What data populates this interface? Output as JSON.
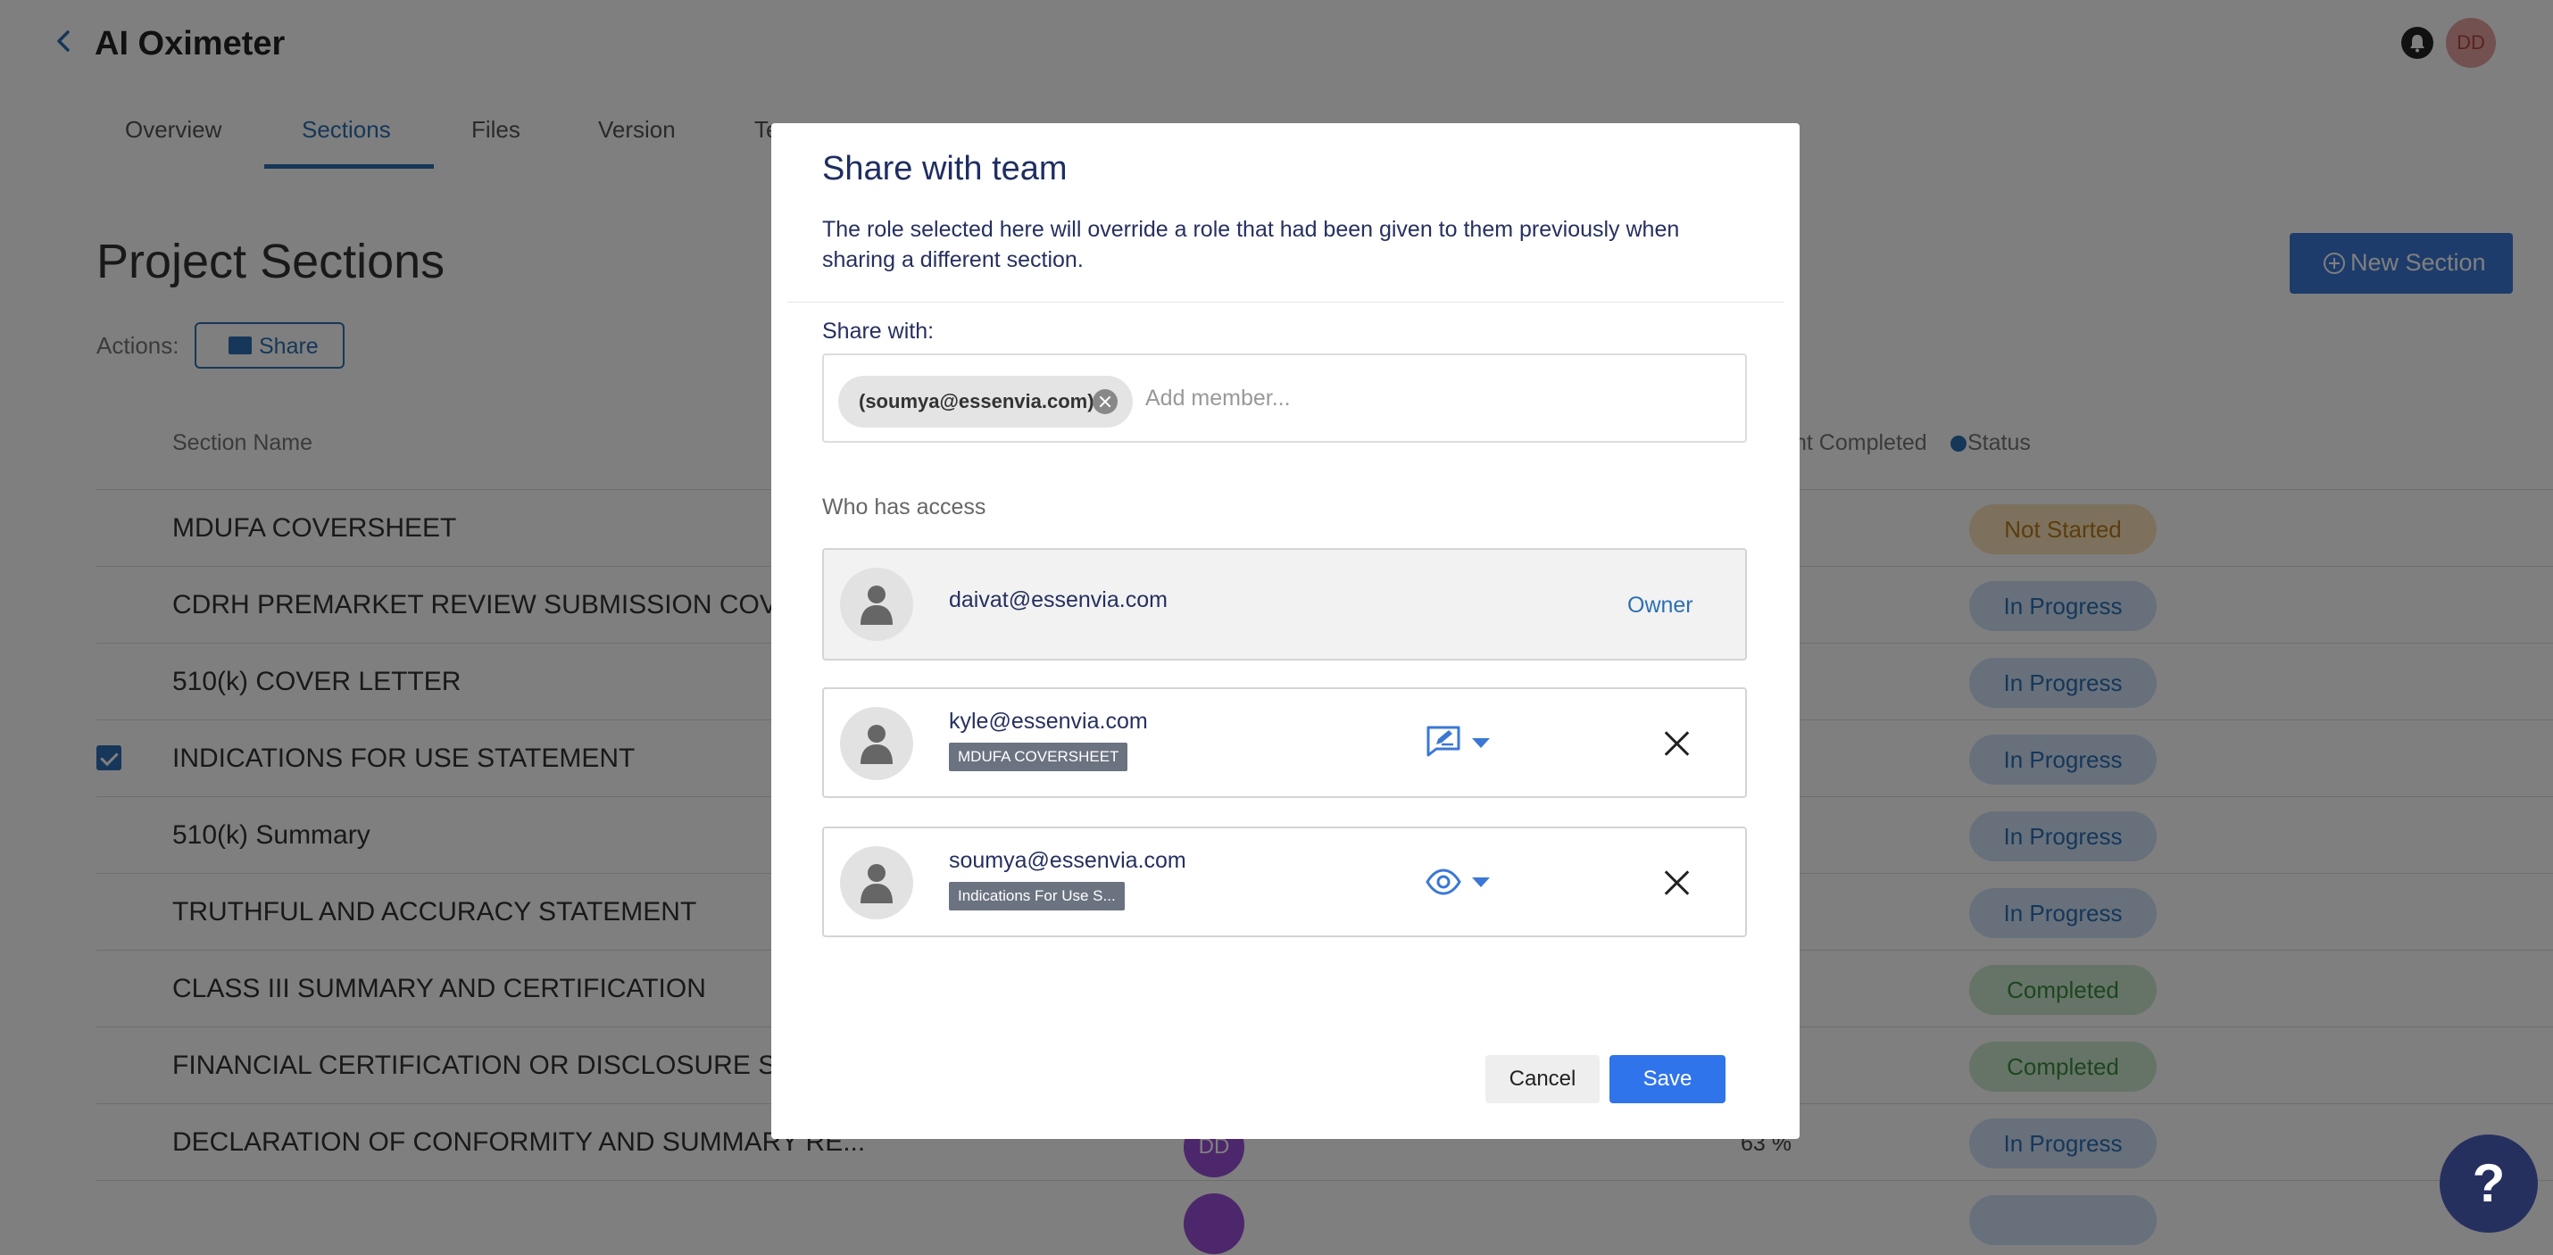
{
  "header": {
    "title": "AI Oximeter",
    "avatar_initials": "DD"
  },
  "tabs": [
    {
      "label": "Overview"
    },
    {
      "label": "Sections"
    },
    {
      "label": "Files"
    },
    {
      "label": "Version"
    },
    {
      "label": "Te"
    }
  ],
  "page": {
    "heading": "Project Sections",
    "actions_label": "Actions:",
    "share_label": "Share",
    "new_section_label": "New Section"
  },
  "table": {
    "columns": {
      "section_name": "Section Name",
      "percent_completed": "nt Completed",
      "status": "Status"
    },
    "rows": [
      {
        "name": "MDUFA COVERSHEET",
        "status": "Not Started",
        "checked": false
      },
      {
        "name": "CDRH PREMARKET REVIEW SUBMISSION COVER",
        "status": "In Progress",
        "checked": false
      },
      {
        "name": "510(k) COVER LETTER",
        "status": "In Progress",
        "checked": false
      },
      {
        "name": "INDICATIONS FOR USE STATEMENT",
        "status": "In Progress",
        "checked": true
      },
      {
        "name": "510(k) Summary",
        "status": "In Progress",
        "checked": false
      },
      {
        "name": "TRUTHFUL AND ACCURACY STATEMENT",
        "status": "In Progress",
        "checked": false
      },
      {
        "name": "CLASS III SUMMARY AND CERTIFICATION",
        "status": "Completed",
        "checked": false
      },
      {
        "name": "FINANCIAL CERTIFICATION OR DISCLOSURE ST...",
        "status": "Completed",
        "checked": false
      },
      {
        "name": "DECLARATION OF CONFORMITY AND SUMMARY RE...",
        "status": "In Progress",
        "checked": false,
        "owner": "DD",
        "percent": "63 %"
      }
    ]
  },
  "modal": {
    "title": "Share with team",
    "description": "The role selected here will override a role that had been given to them previously when sharing a different section.",
    "share_with_label": "Share with:",
    "chip_label": "(soumya@essenvia.com)",
    "add_member_placeholder": "Add member...",
    "who_has_access_label": "Who has access",
    "people": [
      {
        "email": "daivat@essenvia.com",
        "role_label": "Owner"
      },
      {
        "email": "kyle@essenvia.com",
        "tag": "MDUFA COVERSHEET",
        "role_icon": "edit-comment-icon"
      },
      {
        "email": "soumya@essenvia.com",
        "tag": "Indications For Use S...",
        "role_icon": "eye-icon"
      }
    ],
    "cancel_label": "Cancel",
    "save_label": "Save"
  },
  "help_label": "?",
  "colors": {
    "accent": "#2d6fb3",
    "save_button": "#2f74ea",
    "title_navy": "#1f2e60",
    "owner_avatar": "#9b4fd6"
  }
}
